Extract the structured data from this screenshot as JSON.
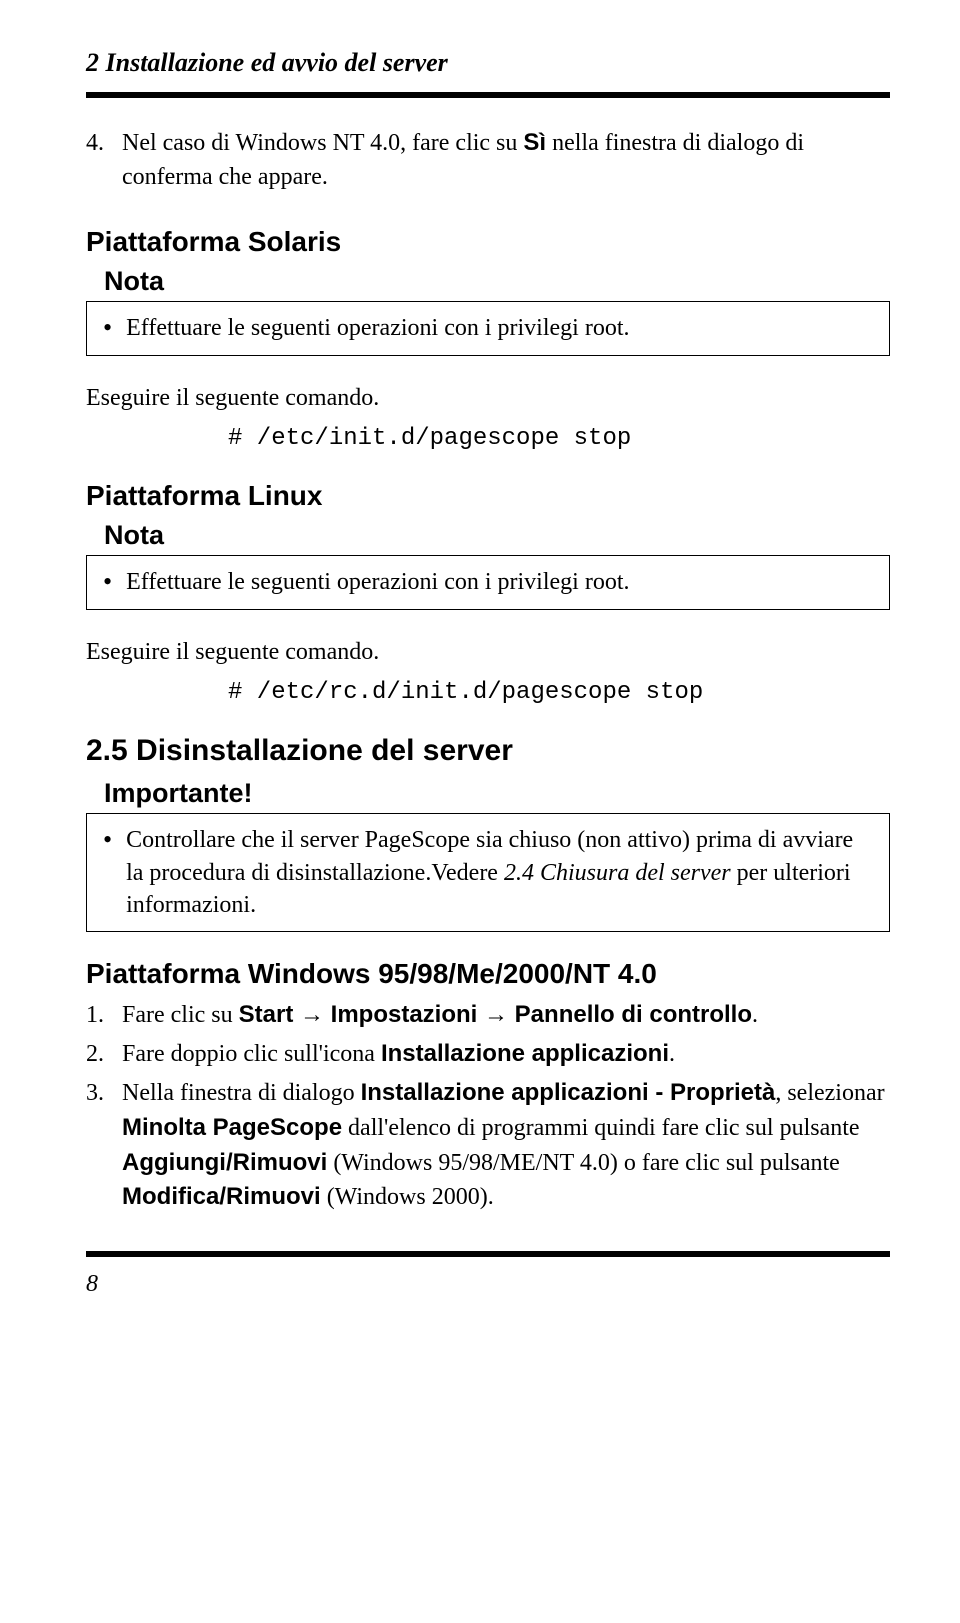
{
  "header": {
    "running_title": "2  Installazione ed avvio del server"
  },
  "step4": {
    "num": "4.",
    "pre": "Nel caso di Windows NT 4.0, fare clic su ",
    "bold": "Sì",
    "post": " nella finestra di dialogo di conferma che appare."
  },
  "solaris": {
    "heading": "Piattaforma Solaris",
    "nota_label": "Nota",
    "bullet": "Effettuare le seguenti operazioni con i privilegi root.",
    "run_label": "Eseguire il seguente comando.",
    "code": "# /etc/init.d/pagescope stop"
  },
  "linux": {
    "heading": "Piattaforma Linux",
    "nota_label": "Nota",
    "bullet": "Effettuare le seguenti operazioni con i privilegi root.",
    "run_label": "Eseguire il seguente comando.",
    "code": "# /etc/rc.d/init.d/pagescope stop"
  },
  "section25": {
    "heading": "2.5  Disinstallazione del server",
    "importante_label": "Importante!",
    "bullet_pre": "Controllare che il server PageScope sia chiuso (non attivo) prima di avviare la procedura di disinstallazione.Vedere ",
    "bullet_ital": "2.4 Chiusura del server",
    "bullet_post": " per ulteriori informazioni."
  },
  "windows": {
    "heading": "Piattaforma Windows 95/98/Me/2000/NT 4.0",
    "items": [
      {
        "num": "1.",
        "pre": "Fare clic su ",
        "b1": "Start",
        "arrow1": " → ",
        "b2": "Impostazioni",
        "arrow2": " → ",
        "b3": "Pannello di controllo",
        "post": "."
      },
      {
        "num": "2.",
        "pre": "Fare doppio clic sull'icona ",
        "b1": "Installazione applicazioni",
        "post": "."
      },
      {
        "num": "3.",
        "pre": "Nella finestra di dialogo ",
        "b1": "Installazione applicazioni - Proprietà",
        "mid1": ", selezionar  ",
        "b2": "Minolta PageScope",
        "mid2": " dall'elenco di programmi quindi fare clic sul pulsante ",
        "b3": "Aggiungi/Rimuovi",
        "mid3": " (Windows 95/98/ME/NT 4.0) o fare clic sul pulsante ",
        "b4": "Modifica/Rimuovi",
        "post": " (Windows 2000)."
      }
    ]
  },
  "footer": {
    "page_number": "8"
  }
}
